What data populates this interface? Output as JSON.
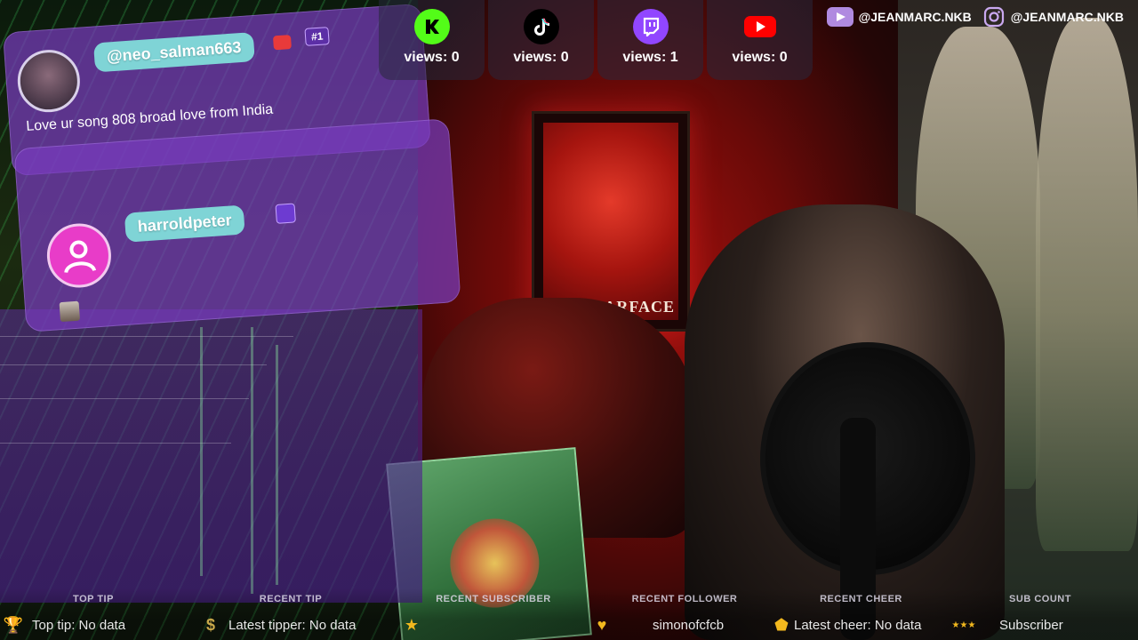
{
  "chat": {
    "messages": [
      {
        "username": "@neo_salman663",
        "text": "Love ur song 808 broad love from India",
        "badge_crown": "#1"
      },
      {
        "username": "harroldpeter",
        "text": ""
      }
    ]
  },
  "views": [
    {
      "platform": "kick",
      "icon": "kick-icon",
      "label": "views: 0",
      "color": "#53fc18"
    },
    {
      "platform": "tiktok",
      "icon": "tiktok-icon",
      "label": "views: 0",
      "color": "#000000"
    },
    {
      "platform": "twitch",
      "icon": "twitch-icon",
      "label": "views: 1",
      "color": "#9146ff"
    },
    {
      "platform": "youtube",
      "icon": "youtube-icon",
      "label": "views: 0",
      "color": "#ff0000"
    }
  ],
  "handles": [
    {
      "icon": "youtube-icon",
      "text": "@JEANMARC.NKB"
    },
    {
      "icon": "instagram-icon",
      "text": "@JEANMARC.NKB"
    }
  ],
  "poster": {
    "title": "SCARFACE"
  },
  "ticker": {
    "top_tip": {
      "title": "TOP TIP",
      "value": "Top tip: No data",
      "icon": "trophy-icon"
    },
    "recent_tip": {
      "title": "RECENT TIP",
      "value": "Latest tipper: No data",
      "icon": "dollar-icon"
    },
    "recent_subscriber": {
      "title": "RECENT SUBSCRIBER",
      "value": "",
      "icon": "star-icon"
    },
    "recent_follower": {
      "title": "RECENT FOLLOWER",
      "value": "simonofcfcb",
      "icon": "heart-icon"
    },
    "recent_cheer": {
      "title": "RECENT CHEER",
      "value": "Latest cheer: No data",
      "icon": "gem-icon"
    },
    "sub_count": {
      "title": "SUB COUNT",
      "value": "Subscriber",
      "icon": "stars-icon"
    }
  },
  "colors": {
    "accent_purple": "#7a3cc4",
    "pill_teal": "#7fd4d6",
    "gold": "#f2b81e"
  }
}
